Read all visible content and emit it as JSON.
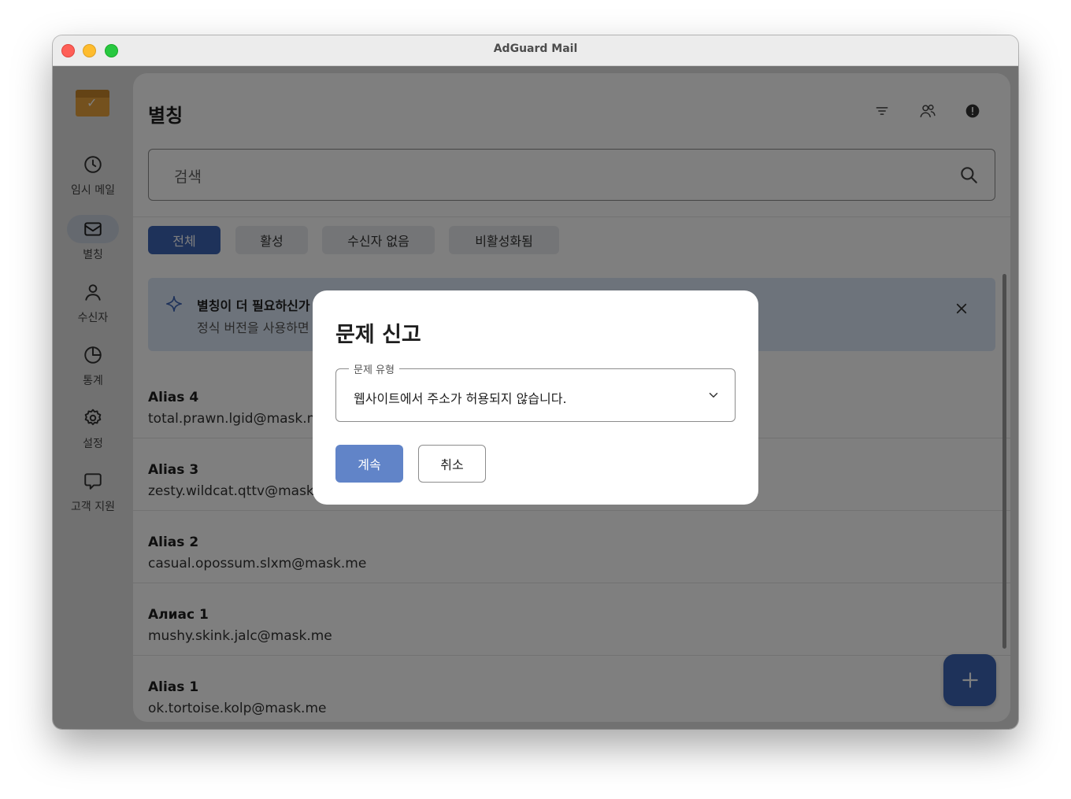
{
  "window": {
    "title": "AdGuard Mail"
  },
  "sidebar": {
    "items": [
      {
        "label": "임시 메일",
        "icon": "clock-icon"
      },
      {
        "label": "별칭",
        "icon": "mail-icon",
        "active": true
      },
      {
        "label": "수신자",
        "icon": "user-icon"
      },
      {
        "label": "통계",
        "icon": "pie-chart-icon"
      },
      {
        "label": "설정",
        "icon": "gear-icon"
      },
      {
        "label": "고객 지원",
        "icon": "chat-icon"
      }
    ]
  },
  "header": {
    "title": "별칭",
    "icons": [
      "filter-icon",
      "users-icon",
      "alert-icon"
    ]
  },
  "search": {
    "placeholder": "검색"
  },
  "filters": [
    {
      "label": "전체",
      "active": true
    },
    {
      "label": "활성"
    },
    {
      "label": "수신자 없음"
    },
    {
      "label": "비활성화됨"
    }
  ],
  "banner": {
    "title": "별칭이 더 필요하신가",
    "subtitle": "정식 버전을 사용하면"
  },
  "aliases": [
    {
      "name": "Alias 4",
      "email": "total.prawn.lgid@mask.me"
    },
    {
      "name": "Alias 3",
      "email": "zesty.wildcat.qttv@mask.me"
    },
    {
      "name": "Alias 2",
      "email": "casual.opossum.slxm@mask.me"
    },
    {
      "name": "Алиас 1",
      "email": "mushy.skink.jalc@mask.me"
    },
    {
      "name": "Alias 1",
      "email": "ok.tortoise.kolp@mask.me"
    }
  ],
  "dialog": {
    "title": "문제 신고",
    "field_label": "문제 유형",
    "selected_value": "웹사이트에서 주소가 허용되지 않습니다.",
    "continue_label": "계속",
    "cancel_label": "취소"
  },
  "colors": {
    "accent": "#3c64b4",
    "accent_dialog": "#6184c8",
    "banner_bg": "#dbe6f6"
  }
}
